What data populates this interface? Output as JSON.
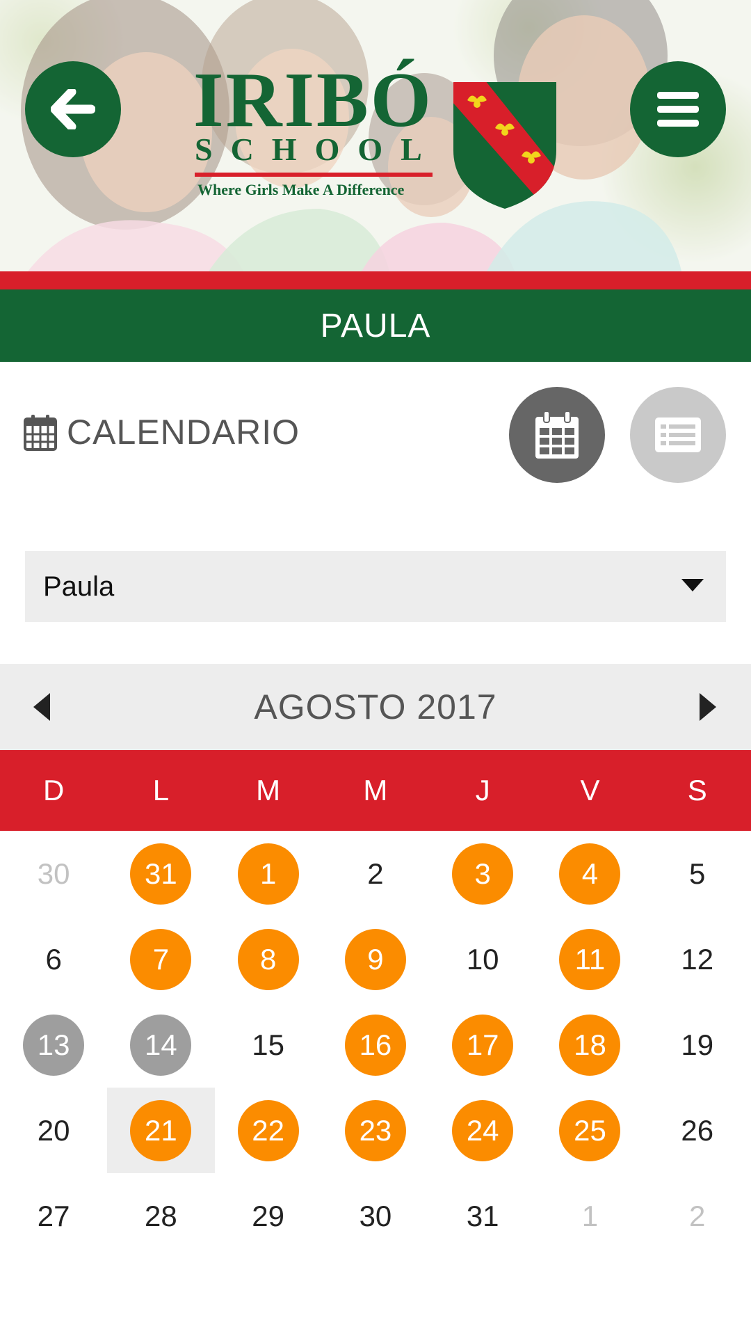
{
  "header": {
    "logo": {
      "name": "IRIBÓ",
      "school": "SCHOOL",
      "tagline": "Where Girls Make A Difference"
    },
    "back_icon": "arrow-left-icon",
    "menu_icon": "hamburger-menu-icon",
    "student_name": "PAULA"
  },
  "section": {
    "icon": "calendar-icon",
    "title": "CALENDARIO",
    "views": [
      {
        "icon": "calendar-grid-icon",
        "active": true
      },
      {
        "icon": "list-icon",
        "active": false
      }
    ]
  },
  "selector": {
    "value": "Paula"
  },
  "calendar": {
    "month_label": "AGOSTO 2017",
    "weekdays": [
      "D",
      "L",
      "M",
      "M",
      "J",
      "V",
      "S"
    ],
    "weeks": [
      [
        {
          "day": "30",
          "state": "muted"
        },
        {
          "day": "31",
          "state": "event"
        },
        {
          "day": "1",
          "state": "event"
        },
        {
          "day": "2",
          "state": "normal"
        },
        {
          "day": "3",
          "state": "event"
        },
        {
          "day": "4",
          "state": "event"
        },
        {
          "day": "5",
          "state": "normal"
        }
      ],
      [
        {
          "day": "6",
          "state": "normal"
        },
        {
          "day": "7",
          "state": "event"
        },
        {
          "day": "8",
          "state": "event"
        },
        {
          "day": "9",
          "state": "event"
        },
        {
          "day": "10",
          "state": "normal"
        },
        {
          "day": "11",
          "state": "event"
        },
        {
          "day": "12",
          "state": "normal"
        }
      ],
      [
        {
          "day": "13",
          "state": "holiday"
        },
        {
          "day": "14",
          "state": "holiday"
        },
        {
          "day": "15",
          "state": "normal"
        },
        {
          "day": "16",
          "state": "event"
        },
        {
          "day": "17",
          "state": "event"
        },
        {
          "day": "18",
          "state": "event"
        },
        {
          "day": "19",
          "state": "normal"
        }
      ],
      [
        {
          "day": "20",
          "state": "normal"
        },
        {
          "day": "21",
          "state": "event",
          "today": true
        },
        {
          "day": "22",
          "state": "event"
        },
        {
          "day": "23",
          "state": "event"
        },
        {
          "day": "24",
          "state": "event"
        },
        {
          "day": "25",
          "state": "event"
        },
        {
          "day": "26",
          "state": "normal"
        }
      ],
      [
        {
          "day": "27",
          "state": "normal"
        },
        {
          "day": "28",
          "state": "normal"
        },
        {
          "day": "29",
          "state": "normal"
        },
        {
          "day": "30",
          "state": "normal"
        },
        {
          "day": "31",
          "state": "normal"
        },
        {
          "day": "1",
          "state": "muted"
        },
        {
          "day": "2",
          "state": "muted"
        }
      ]
    ]
  },
  "colors": {
    "brand_green": "#146534",
    "brand_red": "#d81f2a",
    "event_orange": "#fb8c00",
    "holiday_gray": "#9e9e9e",
    "muted_text": "#c2c2c2"
  }
}
